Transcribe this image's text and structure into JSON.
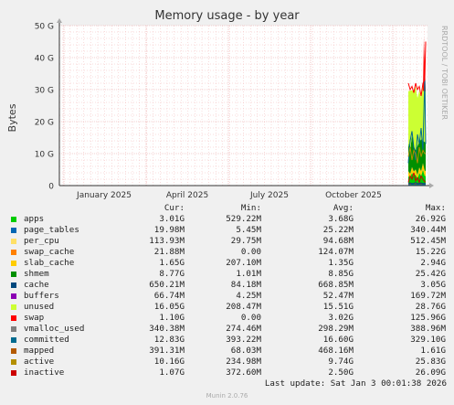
{
  "chart_data": {
    "type": "area",
    "title": "Memory usage - by year",
    "ylabel": "Bytes",
    "ylim": [
      0,
      50
    ],
    "yunit": "G",
    "yticks": [
      "0",
      "10 G",
      "20 G",
      "30 G",
      "40 G",
      "50 G"
    ],
    "xticks": [
      "January 2025",
      "April 2025",
      "July 2025",
      "October 2025"
    ],
    "grid": true,
    "legend_columns": [
      "Cur:",
      "Min:",
      "Avg:",
      "Max:"
    ],
    "series": [
      {
        "name": "apps",
        "color": "#00cc00",
        "cur": "3.01G",
        "min": "529.22M",
        "avg": "3.68G",
        "max": "26.92G"
      },
      {
        "name": "page_tables",
        "color": "#0066b3",
        "cur": "19.98M",
        "min": "5.45M",
        "avg": "25.22M",
        "max": "340.44M"
      },
      {
        "name": "per_cpu",
        "color": "#ffe066",
        "cur": "113.93M",
        "min": "29.75M",
        "avg": "94.68M",
        "max": "512.45M"
      },
      {
        "name": "swap_cache",
        "color": "#ff8000",
        "cur": "21.88M",
        "min": "0.00",
        "avg": "124.07M",
        "max": "15.22G"
      },
      {
        "name": "slab_cache",
        "color": "#ffcc00",
        "cur": "1.65G",
        "min": "207.10M",
        "avg": "1.35G",
        "max": "2.94G"
      },
      {
        "name": "shmem",
        "color": "#008f00",
        "cur": "8.77G",
        "min": "1.01M",
        "avg": "8.85G",
        "max": "25.42G"
      },
      {
        "name": "cache",
        "color": "#00487d",
        "cur": "650.21M",
        "min": "84.18M",
        "avg": "668.85M",
        "max": "3.05G"
      },
      {
        "name": "buffers",
        "color": "#8b00b3",
        "cur": "66.74M",
        "min": "4.25M",
        "avg": "52.47M",
        "max": "169.72M"
      },
      {
        "name": "unused",
        "color": "#ccff33",
        "cur": "16.05G",
        "min": "208.47M",
        "avg": "15.51G",
        "max": "28.76G"
      },
      {
        "name": "swap",
        "color": "#ff0000",
        "cur": "1.10G",
        "min": "0.00",
        "avg": "3.02G",
        "max": "125.96G"
      },
      {
        "name": "vmalloc_used",
        "color": "#808080",
        "cur": "340.38M",
        "min": "274.46M",
        "avg": "298.29M",
        "max": "388.96M"
      },
      {
        "name": "committed",
        "color": "#006b8f",
        "cur": "12.83G",
        "min": "393.22M",
        "avg": "16.60G",
        "max": "329.10G"
      },
      {
        "name": "mapped",
        "color": "#b35a00",
        "cur": "391.31M",
        "min": "68.03M",
        "avg": "468.16M",
        "max": "1.61G"
      },
      {
        "name": "active",
        "color": "#b38f00",
        "cur": "10.16G",
        "min": "234.98M",
        "avg": "9.74G",
        "max": "25.83G"
      },
      {
        "name": "inactive",
        "color": "#cc0000",
        "cur": "1.07G",
        "min": "372.60M",
        "avg": "2.50G",
        "max": "26.09G"
      }
    ]
  },
  "watermark": "RRDTOOL / TOBI OETIKER",
  "last_update": "Last update:  Sat Jan  3 00:01:38 2026",
  "footer": "Munin 2.0.76"
}
